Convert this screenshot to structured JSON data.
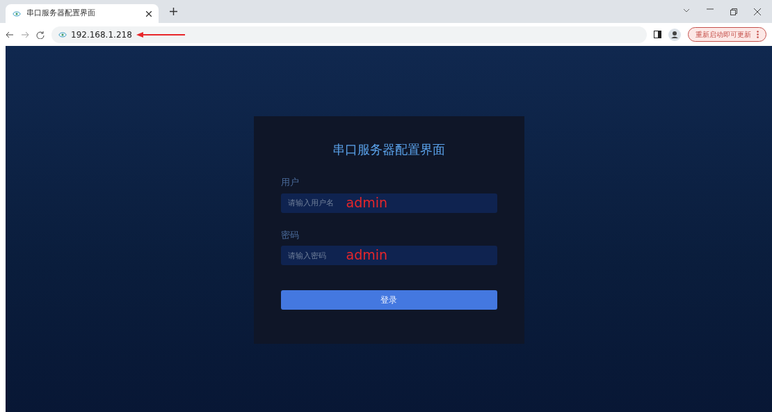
{
  "browser": {
    "tab": {
      "title": "串口服务器配置界面",
      "selected": true
    },
    "address": "192.168.1.218",
    "update_button": "重新启动即可更新"
  },
  "login": {
    "title": "串口服务器配置界面",
    "fields": [
      {
        "label": "用户",
        "placeholder": "请输入用户名",
        "annotation": "admin"
      },
      {
        "label": "密码",
        "placeholder": "请输入密码",
        "annotation": "admin"
      }
    ],
    "submit": "登录"
  }
}
